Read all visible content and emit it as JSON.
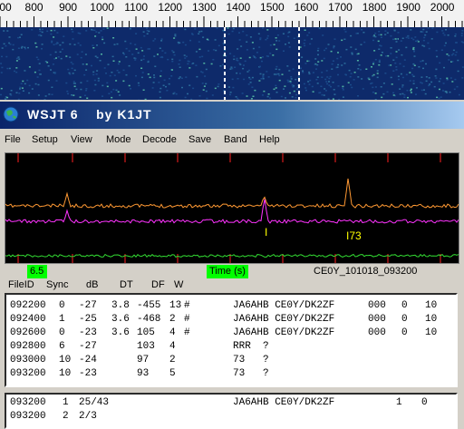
{
  "waterfall": {
    "scale_labels": [
      "00",
      "800",
      "900",
      "1000",
      "1100",
      "1200",
      "1300",
      "1400",
      "1500",
      "1600",
      "1700",
      "1800",
      "1900",
      "2000"
    ]
  },
  "window": {
    "title": "WSJT 6    by K1JT",
    "icon": "globe-icon"
  },
  "menu": [
    "File",
    "Setup",
    "View",
    "Mode",
    "Decode",
    "Save",
    "Band",
    "Help"
  ],
  "plot": {
    "marker_a": "I",
    "marker_b": "I73"
  },
  "status": {
    "left_value": "6.5",
    "time_label": "Time (s)",
    "filename": "CE0Y_101018_093200"
  },
  "columns": [
    "FileID",
    "Sync",
    "dB",
    "DT",
    "DF",
    "W"
  ],
  "decoded": [
    {
      "fileid": "092200",
      "sync": "0",
      "db": "-27",
      "dt": "3.8",
      "df": "-455",
      "w": "13",
      "flag": "#",
      "msg": "JA6AHB CE0Y/DK2ZF",
      "c1": "000",
      "c2": "0",
      "c3": "10"
    },
    {
      "fileid": "092400",
      "sync": "1",
      "db": "-25",
      "dt": "3.6",
      "df": "-468",
      "w": "2",
      "flag": "#",
      "msg": "JA6AHB CE0Y/DK2ZF",
      "c1": "000",
      "c2": "0",
      "c3": "10"
    },
    {
      "fileid": "092600",
      "sync": "0",
      "db": "-23",
      "dt": "3.6",
      "df": "105",
      "w": "4",
      "flag": "#",
      "msg": "JA6AHB CE0Y/DK2ZF",
      "c1": "000",
      "c2": "0",
      "c3": "10"
    },
    {
      "fileid": "092800",
      "sync": "6",
      "db": "-27",
      "dt": "",
      "df": "103",
      "w": "4",
      "flag": "",
      "msg": "RRR  ?",
      "c1": "",
      "c2": "",
      "c3": ""
    },
    {
      "fileid": "093000",
      "sync": "10",
      "db": "-24",
      "dt": "",
      "df": "97",
      "w": "2",
      "flag": "",
      "msg": "73   ?",
      "c1": "",
      "c2": "",
      "c3": ""
    },
    {
      "fileid": "093200",
      "sync": "10",
      "db": "-23",
      "dt": "",
      "df": "93",
      "w": "5",
      "flag": "",
      "msg": "73   ?",
      "c1": "",
      "c2": "",
      "c3": ""
    }
  ],
  "average": [
    {
      "fileid": "093200",
      "n": "1",
      "frac": "25/43",
      "msg": "JA6AHB CE0Y/DK2ZF",
      "a": "1",
      "b": "0"
    },
    {
      "fileid": "093200",
      "n": "2",
      "frac": "2/3",
      "msg": "",
      "a": "",
      "b": ""
    }
  ]
}
